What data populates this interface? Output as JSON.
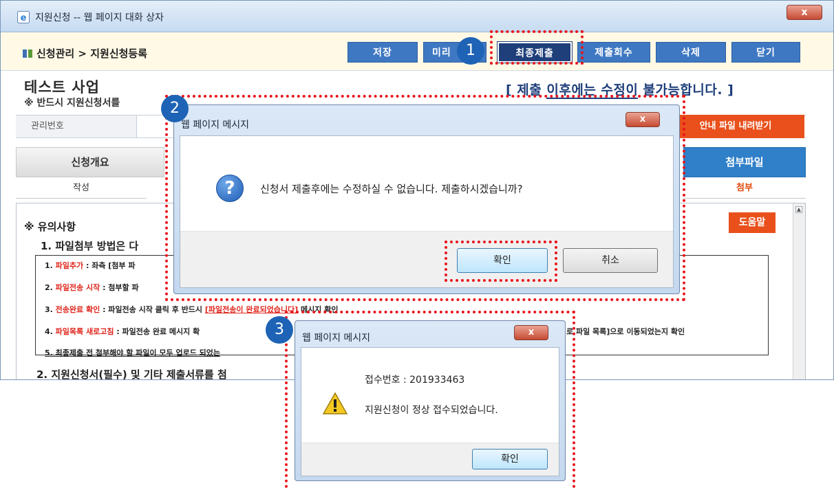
{
  "window": {
    "title": "지원신청 -- 웹 페이지 대화 상자",
    "close_label": "x"
  },
  "toolbar": {
    "breadcrumb": "신청관리 > 지원신청등록",
    "buttons": {
      "save": "저장",
      "preview": "미리",
      "final_submit": "최종제출",
      "withdraw": "제출회수",
      "delete": "삭제",
      "close": "닫기"
    }
  },
  "project": {
    "title": "테스트 사업",
    "notice": "※ 반드시 지원신청서를",
    "warning_prefix": "[ 제출 ",
    "warning_underlined": "이후에는 수정이",
    "warning_suffix": " 불가능합니다. ]"
  },
  "info_row": {
    "label": "관리번호",
    "download_button": "안내 파일 내려받기"
  },
  "steps": [
    {
      "label": "신청개요",
      "sub": "작성"
    },
    {
      "label": "첨부파일",
      "sub": "첨부"
    }
  ],
  "content": {
    "help_button": "도움말",
    "caution_heading": "※ 유의사항",
    "section1": "1. 파일첨부 방법은 다",
    "section2": "2. 지원신청서(필수) 및 기타 제출서류를 첨",
    "items": [
      {
        "num": "1. ",
        "red": "파일추가",
        "text": " : 좌측 [첨부 파"
      },
      {
        "num": "2. ",
        "red": "파일전송 시작",
        "text": " : 첨부할 파"
      },
      {
        "num": "3. ",
        "red": "전송완료 확인",
        "text": " : 파일전송 시작 클릭 후 반드시 ",
        "redu": "[파일전송이 완료되었습니다]",
        "tail": " 메시지 확인"
      },
      {
        "num": "4. ",
        "red": "파일목록 새로고침",
        "text": " : 파일전송 완료 메시지 확",
        "tail": "로 파일 목록]으로 이동되었는지 확인"
      },
      {
        "num": "5. ",
        "text": "최종제출 전 첨부해야 할 파일이 모두 업로드 되었는"
      }
    ]
  },
  "dialog_confirm": {
    "title": "웹 페이지 메시지",
    "close_label": "x",
    "message": "신청서 제출후에는 수정하실 수 없습니다. 제출하시겠습니까?",
    "ok": "확인",
    "cancel": "취소"
  },
  "dialog_receipt": {
    "title": "웹 페이지 메시지",
    "close_label": "x",
    "receipt_line": "접수번호 : 201933463",
    "message": "지원신청이 정상 접수되었습니다.",
    "ok": "확인"
  },
  "annotations": [
    "1",
    "2",
    "3"
  ],
  "colors": {
    "accent_blue": "#3f78c2",
    "orange": "#e9501b",
    "highlight_red": "#e8141b",
    "badge_blue": "#1e63b5"
  }
}
